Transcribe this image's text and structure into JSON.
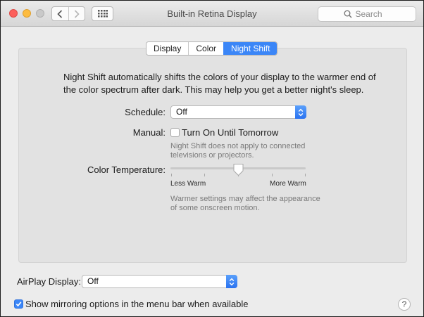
{
  "window": {
    "title": "Built-in Retina Display",
    "search_placeholder": "Search"
  },
  "tabs": [
    {
      "label": "Display",
      "active": false
    },
    {
      "label": "Color",
      "active": false
    },
    {
      "label": "Night Shift",
      "active": true
    }
  ],
  "night_shift": {
    "description": "Night Shift automatically shifts the colors of your display to the warmer end of the color spectrum after dark. This may help you get a better night's sleep.",
    "schedule_label": "Schedule:",
    "schedule_value": "Off",
    "manual_label": "Manual:",
    "manual_checkbox_label": "Turn On Until Tomorrow",
    "manual_checked": false,
    "manual_note": "Night Shift does not apply to connected televisions or projectors.",
    "color_temp_label": "Color Temperature:",
    "slider_min_label": "Less Warm",
    "slider_max_label": "More Warm",
    "slider_level": 0.5,
    "slider_note": "Warmer settings may affect the appearance of some onscreen motion."
  },
  "airplay": {
    "label": "AirPlay Display:",
    "value": "Off"
  },
  "mirroring": {
    "label": "Show mirroring options in the menu bar when available",
    "checked": true
  },
  "help": {
    "glyph": "?"
  },
  "colors": {
    "accent": "#3b86f7",
    "close": "#fc605c",
    "minimize": "#fdbc40"
  }
}
